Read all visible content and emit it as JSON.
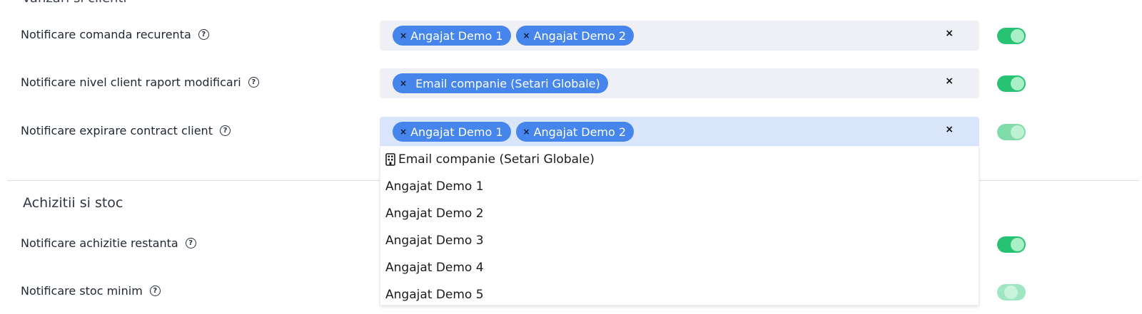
{
  "section_sales": {
    "title": "Vanzari si clienti"
  },
  "rows": [
    {
      "label": "Notificare comanda recurenta",
      "chips": [
        "Angajat Demo 1",
        "Angajat Demo 2"
      ],
      "toggle_on": true
    },
    {
      "label": "Notificare nivel client raport modificari",
      "chips": [
        "Email companie (Setari Globale)"
      ],
      "toggle_on": true
    },
    {
      "label": "Notificare expirare contract client",
      "chips": [
        "Angajat Demo 1",
        "Angajat Demo 2"
      ],
      "toggle_on": true,
      "dropdown_open": true
    }
  ],
  "dropdown": {
    "options": [
      {
        "label": "Email companie (Setari Globale)",
        "icon": "building-icon"
      },
      {
        "label": "Angajat Demo 1"
      },
      {
        "label": "Angajat Demo 2"
      },
      {
        "label": "Angajat Demo 3"
      },
      {
        "label": "Angajat Demo 4"
      },
      {
        "label": "Angajat Demo 5"
      }
    ]
  },
  "section_purchases": {
    "title": "Achizitii si stoc",
    "rows": [
      {
        "label": "Notificare achizitie restanta",
        "toggle_on": true
      },
      {
        "label": "Notificare stoc minim",
        "toggle_on": false
      }
    ]
  },
  "icons": {
    "help": "question-circle-icon",
    "remove_chip": "x-icon",
    "clear": "x-icon"
  },
  "symbols": {
    "help": "?",
    "remove": "×",
    "clear": "×"
  },
  "colors": {
    "chip": "#4585ec",
    "toggle_on": "#27c373",
    "select_bg": "#eff0f5",
    "select_active_bg": "#d9e5fb"
  }
}
